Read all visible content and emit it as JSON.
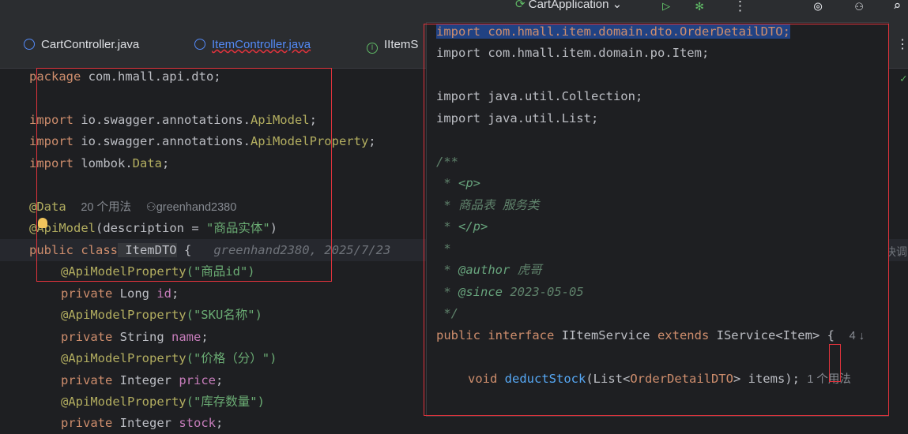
{
  "toolbar": {
    "run_config": "CartApplication",
    "run_config_chevron": "⌄"
  },
  "tabs": [
    {
      "label": "CartController.java",
      "icon": "class-icon"
    },
    {
      "label": "ItemController.java",
      "icon": "class-icon"
    },
    {
      "label": "IItemS",
      "icon": "interface-icon"
    }
  ],
  "editor": {
    "lines": {
      "l1_kw": "package",
      "l1_rest": " com.hmall.api.dto;",
      "l3_kw": "import",
      "l3_rest": " io.swagger.annotations.",
      "l3_ann": "ApiModel",
      "l3_end": ";",
      "l4_kw": "import",
      "l4_rest": " io.swagger.annotations.",
      "l4_ann": "ApiModelProperty",
      "l4_end": ";",
      "l5_kw": "import",
      "l5_rest": " lombok.",
      "l5_ann": "Data",
      "l5_end": ";",
      "l7_ann": "@Data",
      "l7_usages": "20 个用法",
      "l7_author": "greenhand2380",
      "l8_ann": "@ApiModel",
      "l8_rest": "(description = ",
      "l8_str": "\"商品实体\"",
      "l8_end": ")",
      "l9_kw": "public class",
      "l9_name": " ItemDTO",
      " l9_end": " {",
      "l9_blame": "greenhand2380, 2025/7/23",
      "l10_ann": "@ApiModelProperty",
      "l10_str": "(\"商品id\")",
      "l11_kw": "private",
      "l11_type": " Long ",
      "l11_fld": "id",
      "l11_end": ";",
      "l12_ann": "@ApiModelProperty",
      "l12_str": "(\"SKU名称\")",
      "l13_kw": "private",
      "l13_type": " String ",
      "l13_fld": "name",
      "l13_end": ";",
      "l14_ann": "@ApiModelProperty",
      "l14_str": "(\"价格（分）\")",
      "l15_kw": "private",
      "l15_type": " Integer ",
      "l15_fld": "price",
      "l15_end": ";",
      "l16_ann": "@ApiModelProperty",
      "l16_str": "(\"库存数量\")",
      "l17_kw": "private",
      "l17_type": " Integer ",
      "l17_fld": "stock",
      "l17_end": ";"
    },
    "right_trunc": "块调"
  },
  "popup": {
    "p1": "import com.hmall.item.domain.dto.OrderDetailDTO;",
    "p2": "import com.hmall.item.domain.po.Item;",
    "p4": "import java.util.Collection;",
    "p5": "import java.util.List;",
    "p7": "/**",
    "p8a": " * ",
    "p8b": "<p>",
    "p9": " * 商品表 服务类",
    "p10a": " * ",
    "p10b": "</p>",
    "p11": " *",
    "p12a": " * ",
    "p12b": "@author",
    "p12c": " 虎哥",
    "p13a": " * ",
    "p13b": "@since",
    "p13c": " 2023-05-05",
    "p14": " */",
    "p15_kw": "public interface",
    "p15_name": " IItemService ",
    "p15_kw2": "extends",
    "p15_rest": " IService<Item> {",
    "p15_hint": "4 ↓",
    "p17_kw": "void ",
    "p17_m": "deductStock",
    "p17_a": "(List<",
    "p17_t": "OrderDetailDTO",
    "p17_b": "> items);",
    "p17_hint": "1 个用法"
  }
}
